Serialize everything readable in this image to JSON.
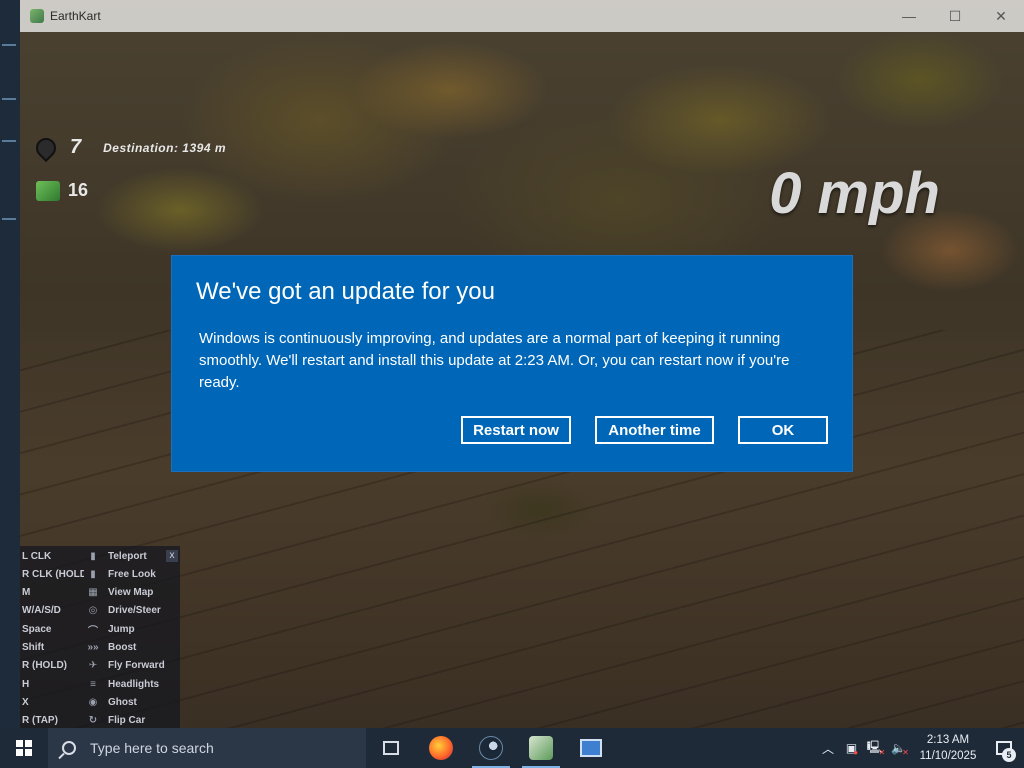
{
  "window": {
    "title": "EarthKart",
    "minimize_glyph": "—",
    "maximize_glyph": "☐",
    "close_glyph": "✕"
  },
  "hud": {
    "pin_count": "7",
    "destination": "Destination: 1394 m",
    "cash_count": "16",
    "speed": "0 mph"
  },
  "controls": {
    "close_glyph": "x",
    "rows": [
      {
        "key": "L CLK",
        "icon": "mouse-left-icon",
        "action": "Teleport"
      },
      {
        "key": "R CLK (HOLD)",
        "icon": "mouse-right-icon",
        "action": "Free Look"
      },
      {
        "key": "M",
        "icon": "map-icon",
        "action": "View Map"
      },
      {
        "key": "W/A/S/D",
        "icon": "steering-wheel-icon",
        "action": "Drive/Steer"
      },
      {
        "key": "Space",
        "icon": "jump-icon",
        "action": "Jump"
      },
      {
        "key": "Shift",
        "icon": "boost-chevrons-icon",
        "action": "Boost"
      },
      {
        "key": "R (HOLD)",
        "icon": "fly-icon",
        "action": "Fly Forward"
      },
      {
        "key": "H",
        "icon": "headlights-icon",
        "action": "Headlights"
      },
      {
        "key": "X",
        "icon": "ghost-icon",
        "action": "Ghost"
      },
      {
        "key": "R (TAP)",
        "icon": "flip-icon",
        "action": "Flip Car"
      }
    ]
  },
  "dialog": {
    "title": "We've got an update for you",
    "body": "Windows is continuously improving, and updates are a normal part of keeping it running smoothly. We'll restart and install this update at 2:23 AM. Or, you can restart now if you're ready.",
    "restart_label": "Restart now",
    "another_time_label": "Another time",
    "ok_label": "OK",
    "bg_color": "#0067b8"
  },
  "taskbar": {
    "search_placeholder": "Type here to search",
    "time": "2:13 AM",
    "date": "11/10/2025",
    "notification_count": "5"
  }
}
